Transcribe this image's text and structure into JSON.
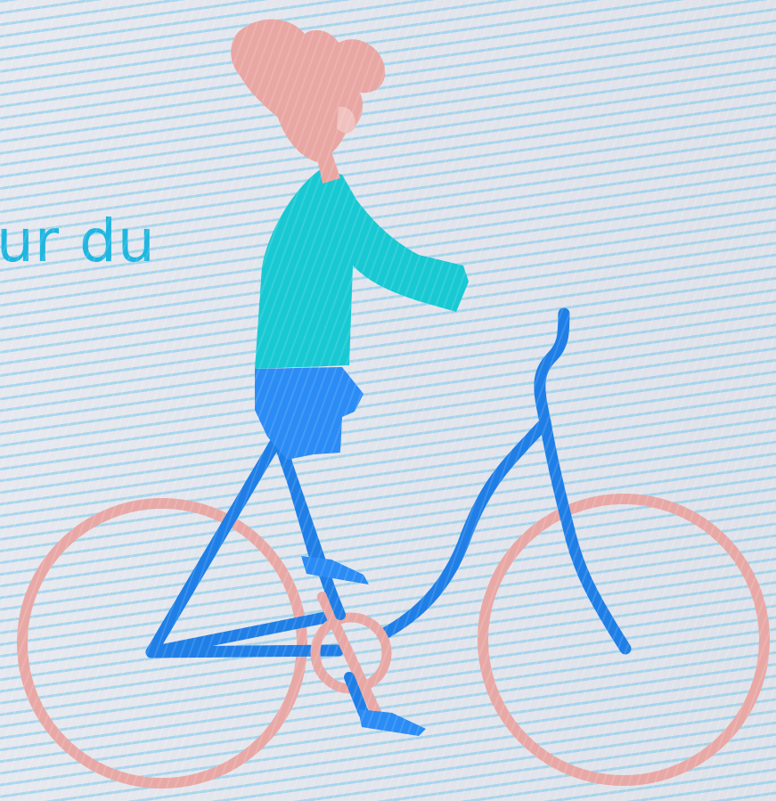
{
  "caption": "ur du",
  "illustration": {
    "subject": "woman-riding-bicycle",
    "colors": {
      "hair": "#e9a7a4",
      "sweater": "#18c9d3",
      "shorts": "#2b8cf5",
      "frame": "#1f7fe6",
      "wheels": "#e8a9a6",
      "text": "#1fb6e0",
      "background": "#e2e5ec"
    }
  }
}
